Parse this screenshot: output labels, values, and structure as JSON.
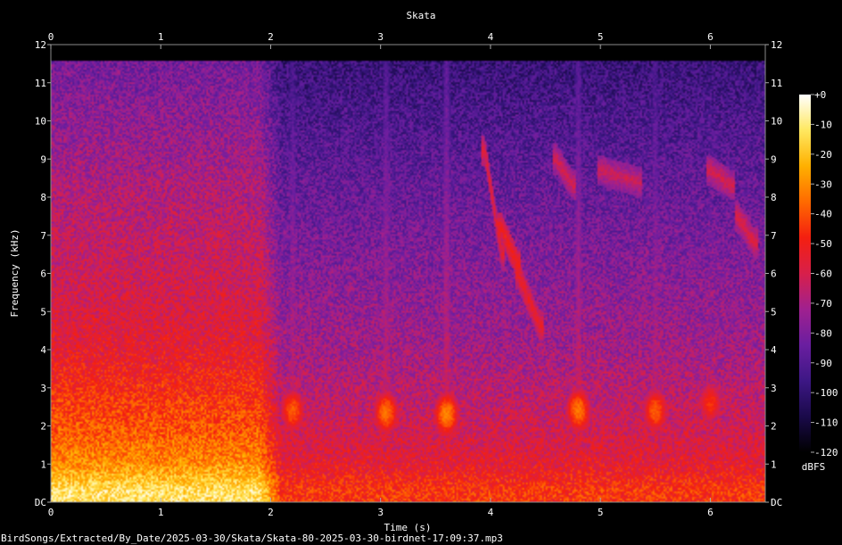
{
  "chart_data": {
    "type": "heatmap",
    "title": "Skata",
    "xlabel": "Time (s)",
    "ylabel": "Frequency (kHz)",
    "xlim": [
      0,
      6.5
    ],
    "ylim": [
      0,
      12
    ],
    "x_ticks": [
      "0",
      "1",
      "2",
      "3",
      "4",
      "5",
      "6"
    ],
    "y_ticks": [
      "DC",
      "1",
      "2",
      "3",
      "4",
      "5",
      "6",
      "7",
      "8",
      "9",
      "10",
      "11",
      "12"
    ],
    "colorbar": {
      "label": "dBFS",
      "range": [
        -120,
        0
      ],
      "ticks": [
        "+0",
        "-10",
        "-20",
        "-30",
        "-40",
        "-50",
        "-60",
        "-70",
        "-80",
        "-90",
        "-100",
        "-110",
        "-120"
      ],
      "colors": [
        "#000000",
        "#1a0a4a",
        "#3d1785",
        "#6a1ea0",
        "#a0208f",
        "#d81f4a",
        "#f41f10",
        "#ff6a00",
        "#ffb000",
        "#ffe860",
        "#ffffff"
      ]
    },
    "noise_floor": {
      "levels": [
        {
          "freq": 0.3,
          "before_2s": -12,
          "after_2s": -45
        },
        {
          "freq": 1,
          "before_2s": -30,
          "after_2s": -55
        },
        {
          "freq": 2,
          "before_2s": -40,
          "after_2s": -62
        },
        {
          "freq": 4,
          "before_2s": -55,
          "after_2s": -72
        },
        {
          "freq": 6,
          "before_2s": -62,
          "after_2s": -78
        },
        {
          "freq": 8,
          "before_2s": -68,
          "after_2s": -85
        },
        {
          "freq": 10,
          "before_2s": -76,
          "after_2s": -92
        },
        {
          "freq": 11.6,
          "before_2s": -82,
          "after_2s": -98
        }
      ],
      "cutoff_khz": 11.6
    },
    "calls": [
      {
        "t": 2.2,
        "f": 2.4,
        "dbfs": -38
      },
      {
        "t": 3.05,
        "f": 2.35,
        "dbfs": -35
      },
      {
        "t": 3.6,
        "f": 2.3,
        "dbfs": -32
      },
      {
        "t": 4.8,
        "f": 2.4,
        "dbfs": -34
      },
      {
        "t": 5.5,
        "f": 2.4,
        "dbfs": -38
      },
      {
        "t": 6.0,
        "f": 2.6,
        "dbfs": -45
      }
    ],
    "chirps": [
      {
        "t0": 3.95,
        "f0": 9.2,
        "t1": 4.1,
        "f1": 6.5,
        "dbfs": -55
      },
      {
        "t0": 4.1,
        "f0": 7.2,
        "t1": 4.25,
        "f1": 6.2,
        "dbfs": -50
      },
      {
        "t0": 4.25,
        "f0": 6.0,
        "t1": 4.45,
        "f1": 4.6,
        "dbfs": -52
      },
      {
        "t0": 4.6,
        "f0": 9.0,
        "t1": 4.75,
        "f1": 8.3,
        "dbfs": -60
      },
      {
        "t0": 5.0,
        "f0": 8.7,
        "t1": 5.35,
        "f1": 8.4,
        "dbfs": -62
      },
      {
        "t0": 6.0,
        "f0": 8.7,
        "t1": 6.2,
        "f1": 8.3,
        "dbfs": -60
      },
      {
        "t0": 6.25,
        "f0": 7.5,
        "t1": 6.4,
        "f1": 6.8,
        "dbfs": -58
      }
    ]
  },
  "footer": {
    "path": "BirdSongs/Extracted/By_Date/2025-03-30/Skata/Skata-80-2025-03-30-birdnet-17:09:37.mp3"
  }
}
